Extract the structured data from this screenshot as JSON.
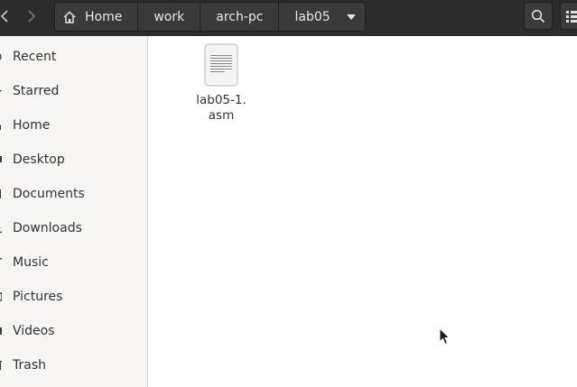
{
  "header": {
    "breadcrumbs": [
      {
        "label": "Home",
        "icon": "home-icon"
      },
      {
        "label": "work"
      },
      {
        "label": "arch-pc"
      },
      {
        "label": "lab05",
        "current": true
      }
    ],
    "search_icon": "search-icon",
    "view_icon": "list-view-icon",
    "colors": {
      "header_bg": "#2c2c2c",
      "crumb_bg": "#3a3a3a",
      "text": "#e8e8e8"
    }
  },
  "sidebar": {
    "items": [
      {
        "label": "Recent",
        "icon": "clock-icon"
      },
      {
        "label": "Starred",
        "icon": "star-icon"
      },
      {
        "label": "Home",
        "icon": "home-icon"
      },
      {
        "label": "Desktop",
        "icon": "desktop-icon"
      },
      {
        "label": "Documents",
        "icon": "documents-icon"
      },
      {
        "label": "Downloads",
        "icon": "downloads-icon"
      },
      {
        "label": "Music",
        "icon": "music-icon"
      },
      {
        "label": "Pictures",
        "icon": "pictures-icon"
      },
      {
        "label": "Videos",
        "icon": "videos-icon"
      },
      {
        "label": "Trash",
        "icon": "trash-icon"
      }
    ]
  },
  "main": {
    "files": [
      {
        "name_line1": "lab05-1.",
        "name_line2": "asm",
        "icon": "text-file-icon"
      }
    ]
  }
}
